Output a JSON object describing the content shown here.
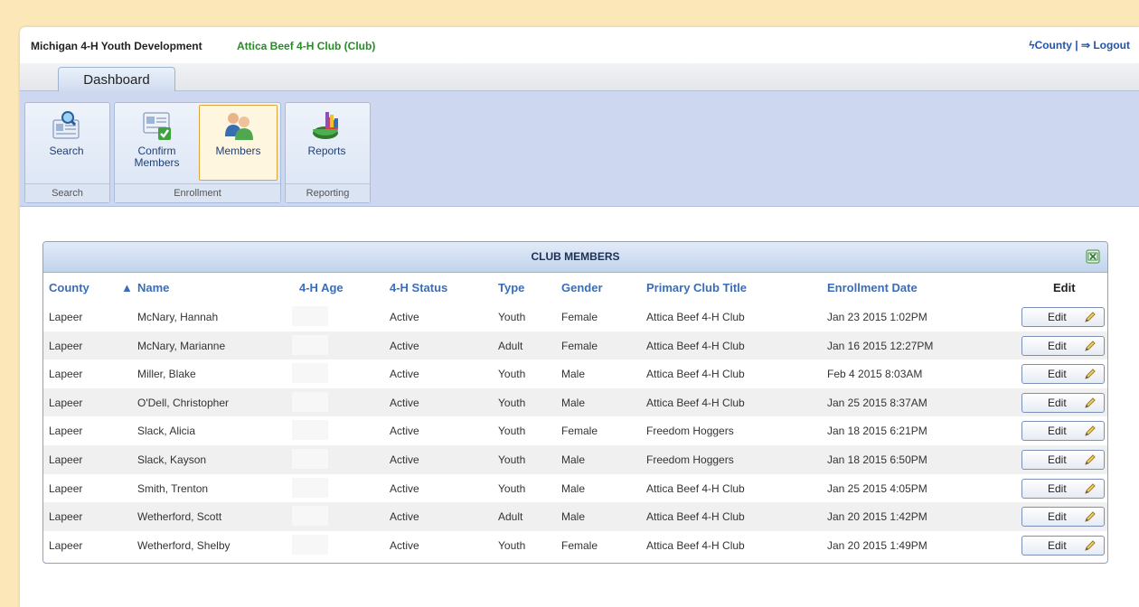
{
  "header": {
    "app_title": "Michigan 4-H Youth Development",
    "club_name": "Attica Beef 4-H Club (Club)",
    "county_link": "County",
    "separator": "|",
    "logout_link": "Logout"
  },
  "tabs": [
    {
      "label": "Dashboard"
    }
  ],
  "ribbon": {
    "groups": [
      {
        "label": "Search",
        "buttons": [
          {
            "label": "Search",
            "icon": "search-card-icon"
          }
        ]
      },
      {
        "label": "Enrollment",
        "buttons": [
          {
            "label_line1": "Confirm",
            "label_line2": "Members",
            "icon": "confirm-members-icon"
          },
          {
            "label": "Members",
            "icon": "members-icon",
            "selected": true
          }
        ]
      },
      {
        "label": "Reporting",
        "buttons": [
          {
            "label": "Reports",
            "icon": "pie-chart-icon"
          }
        ]
      }
    ]
  },
  "table": {
    "title": "CLUB MEMBERS",
    "sort_indicator": "▲",
    "columns": [
      "County",
      "Name",
      "4-H Age",
      "4-H Status",
      "Type",
      "Gender",
      "Primary Club Title",
      "Enrollment Date",
      "Edit"
    ],
    "edit_label": "Edit",
    "rows": [
      {
        "county": "Lapeer",
        "name": "McNary, Hannah",
        "age": "",
        "status": "Active",
        "type": "Youth",
        "gender": "Female",
        "club": "Attica Beef 4-H Club",
        "date": "Jan 23 2015 1:02PM"
      },
      {
        "county": "Lapeer",
        "name": "McNary, Marianne",
        "age": "",
        "status": "Active",
        "type": "Adult",
        "gender": "Female",
        "club": "Attica Beef 4-H Club",
        "date": "Jan 16 2015 12:27PM"
      },
      {
        "county": "Lapeer",
        "name": "Miller, Blake",
        "age": "",
        "status": "Active",
        "type": "Youth",
        "gender": "Male",
        "club": "Attica Beef 4-H Club",
        "date": "Feb 4 2015 8:03AM"
      },
      {
        "county": "Lapeer",
        "name": "O'Dell, Christopher",
        "age": "",
        "status": "Active",
        "type": "Youth",
        "gender": "Male",
        "club": "Attica Beef 4-H Club",
        "date": "Jan 25 2015 8:37AM"
      },
      {
        "county": "Lapeer",
        "name": "Slack, Alicia",
        "age": "",
        "status": "Active",
        "type": "Youth",
        "gender": "Female",
        "club": "Freedom Hoggers",
        "date": "Jan 18 2015 6:21PM"
      },
      {
        "county": "Lapeer",
        "name": "Slack, Kayson",
        "age": "",
        "status": "Active",
        "type": "Youth",
        "gender": "Male",
        "club": "Freedom Hoggers",
        "date": "Jan 18 2015 6:50PM"
      },
      {
        "county": "Lapeer",
        "name": "Smith, Trenton",
        "age": "",
        "status": "Active",
        "type": "Youth",
        "gender": "Male",
        "club": "Attica Beef 4-H Club",
        "date": "Jan 25 2015 4:05PM"
      },
      {
        "county": "Lapeer",
        "name": "Wetherford, Scott",
        "age": "",
        "status": "Active",
        "type": "Adult",
        "gender": "Male",
        "club": "Attica Beef 4-H Club",
        "date": "Jan 20 2015 1:42PM"
      },
      {
        "county": "Lapeer",
        "name": "Wetherford, Shelby",
        "age": "",
        "status": "Active",
        "type": "Youth",
        "gender": "Female",
        "club": "Attica Beef 4-H Club",
        "date": "Jan 20 2015 1:49PM"
      }
    ]
  },
  "colors": {
    "page_background": "#fce7b8",
    "club_name": "#2a8a2a",
    "link": "#2255aa",
    "column_header": "#3c6db4",
    "ribbon": "#cdd8f0",
    "selected_border": "#e0a53a"
  }
}
